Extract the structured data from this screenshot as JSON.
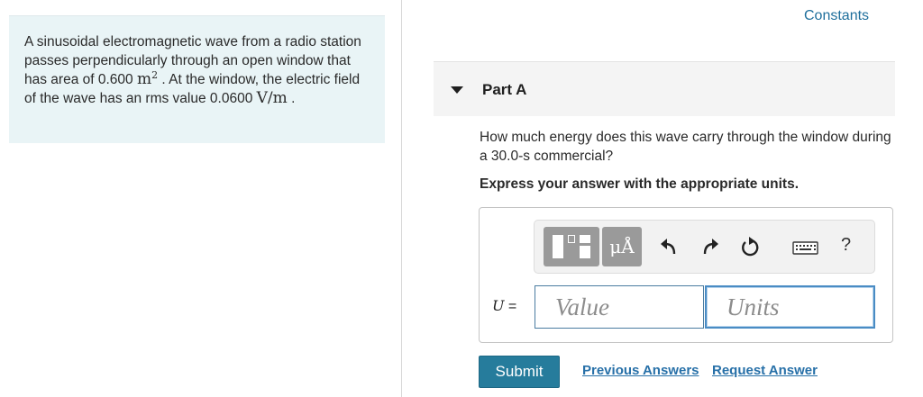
{
  "problem": {
    "text_1": "A sinusoidal electromagnetic wave from a radio station passes perpendicularly through an open window that has area of 0.600 ",
    "area_unit": "m",
    "area_exp": "2",
    "text_2": " . At the window, the electric field of the wave has an rms value ",
    "field_value": "0.0600 ",
    "field_unit": "V/m",
    "text_3": " ."
  },
  "header": {
    "constants_label": "Constants"
  },
  "part": {
    "title": "Part A",
    "question": "How much energy does this wave carry through the window during a 30.0-s commercial?",
    "instruction": "Express your answer with the appropriate units."
  },
  "toolbar": {
    "units_button_label": "μÅ",
    "icons": [
      "templates-icon",
      "undo-icon",
      "redo-icon",
      "reset-icon",
      "keyboard-icon",
      "help-icon"
    ],
    "help_label": "?"
  },
  "answer": {
    "variable": "U",
    "equals": " =",
    "value_placeholder": "Value",
    "units_placeholder": "Units",
    "value": "",
    "units": ""
  },
  "actions": {
    "submit_label": "Submit",
    "previous_answers_label": "Previous Answers",
    "request_answer_label": "Request Answer"
  }
}
